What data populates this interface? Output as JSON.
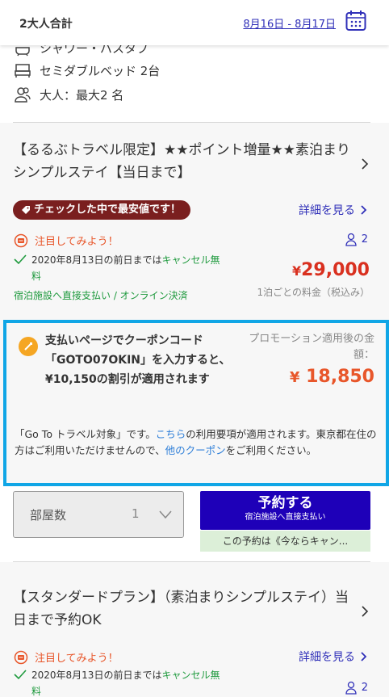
{
  "header": {
    "guests": "2大人合計",
    "dates": "8月16日 - 8月17日"
  },
  "room": {
    "amenities": [
      {
        "label": "シャワー・バスタブ",
        "icon": "bath-icon"
      },
      {
        "label": "セミダブルベッド 2台",
        "icon": "bed-icon"
      },
      {
        "label": "大人：最大2 名",
        "icon": "people-icon"
      }
    ]
  },
  "plan1": {
    "title": "【るるぶトラベル限定】★★ポイント増量★★素泊まりシンプルステイ【当日まで】",
    "badge": "チェックした中で最安値です！",
    "detail_link": "詳細を見る",
    "notice": "注目してみよう！",
    "cancel_text": "2020年8月13日の前日までは",
    "cancel_free": "キャンセル無料",
    "payment": "宿泊施設へ直接支払い / オンライン決済",
    "pax": "2",
    "price_yen": "¥",
    "price": "29,000",
    "per_night": "1泊ごとの料金（税込み）"
  },
  "promo": {
    "message": "支払いページでクーポンコード「GOTO07OKIN」を入力すると、¥10,150の割引が適用されます",
    "after_label": "プロモーション適用後の金額：",
    "after_price_yen": "¥",
    "after_price": "18,850",
    "goto_prefix": "「Go To トラベル対象」です。",
    "goto_link1": "こちら",
    "goto_mid": "の利用要項が適用されます。東京都在住の方はご利用いただけませんので、",
    "goto_link2": "他のクーポン",
    "goto_suffix": "をご利用ください。"
  },
  "booking": {
    "rooms_label": "部屋数",
    "rooms_value": "1",
    "reserve_label": "予約する",
    "reserve_sub": "宿泊施設へ直接支払い",
    "reserve_note": "この予約は《今ならキャン..."
  },
  "plan2": {
    "title": "【スタンダードプラン】（素泊まりシンプルステイ）当日まで予約OK",
    "detail_link": "詳細を見る",
    "notice": "注目してみよう！",
    "cancel_text": "2020年8月13日の前日までは",
    "cancel_free": "キャンセル無料",
    "pax": "2"
  },
  "colors": {
    "link": "#2f2fb8",
    "price_red": "#d9301f",
    "promo_border": "#10a6e6",
    "reserve_bg": "#1e00b8",
    "badge_bg": "#7a1f1f",
    "green": "#1f9a3e"
  }
}
